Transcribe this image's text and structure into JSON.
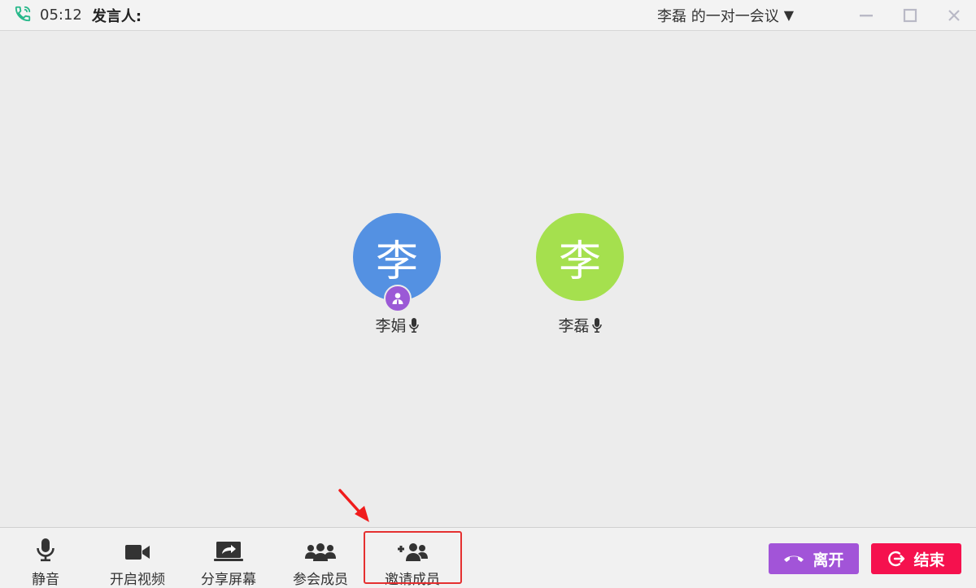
{
  "titlebar": {
    "time": "05:12",
    "speaker_label": "发言人:",
    "meeting_title": "李磊 的一对一会议",
    "dropdown_caret": "▼"
  },
  "participants": [
    {
      "avatar_char": "李",
      "name": "李娟",
      "color": "#5491e2",
      "is_host": true
    },
    {
      "avatar_char": "李",
      "name": "李磊",
      "color": "#a5e04e",
      "is_host": false
    }
  ],
  "toolbar": {
    "mute": "静音",
    "video": "开启视频",
    "share": "分享屏幕",
    "members": "参会成员",
    "invite": "邀请成员",
    "leave": "离开",
    "end": "结束"
  },
  "colors": {
    "leave_button": "#a254d8",
    "end_button": "#f5114e",
    "host_badge": "#9b59d6",
    "phone_icon": "#27b88a",
    "highlight": "#e53030"
  }
}
